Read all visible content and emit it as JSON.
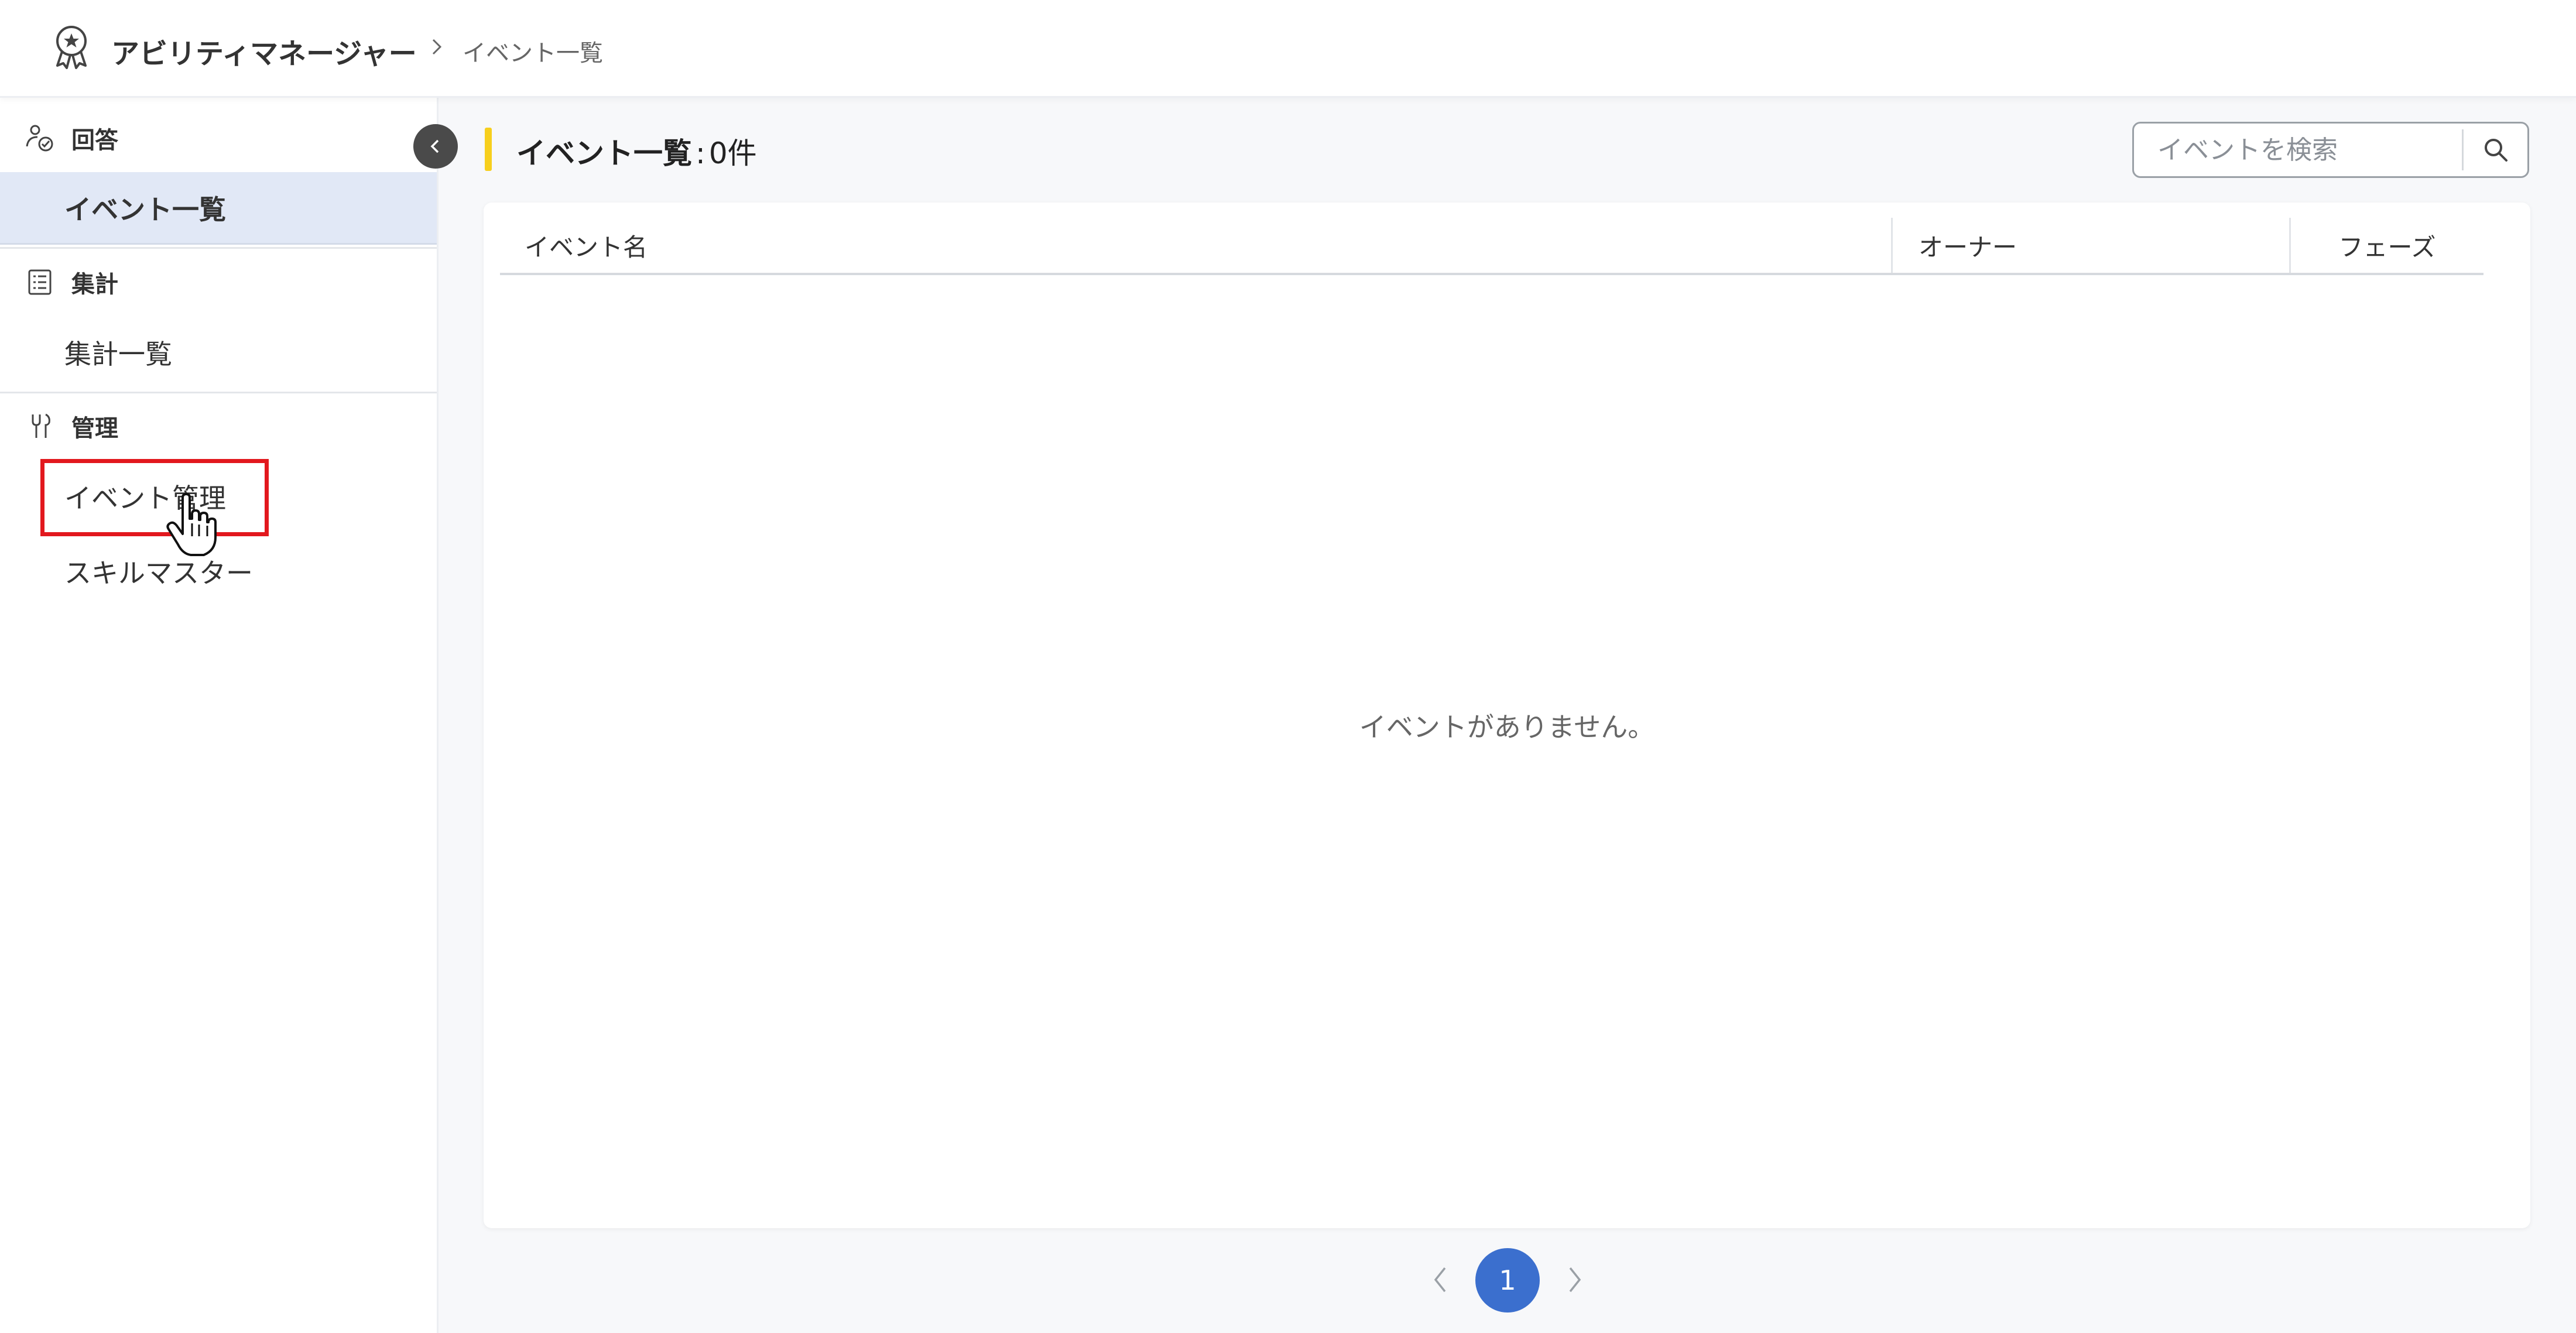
{
  "header": {
    "app_title": "アビリティマネージャー",
    "breadcrumb_current": "イベント一覧",
    "logo_icon": "award-badge-icon",
    "separator_icon": "chevron-right-icon"
  },
  "sidebar": {
    "collapse_icon": "chevron-left-icon",
    "sections": [
      {
        "title": "回答",
        "icon": "person-check-icon",
        "items": [
          {
            "label": "イベント一覧",
            "active": true
          }
        ]
      },
      {
        "title": "集計",
        "icon": "list-document-icon",
        "items": [
          {
            "label": "集計一覧",
            "active": false
          }
        ]
      },
      {
        "title": "管理",
        "icon": "tools-icon",
        "items": [
          {
            "label": "イベント管理",
            "active": false,
            "highlighted": true
          },
          {
            "label": "スキルマスター",
            "active": false
          }
        ]
      }
    ]
  },
  "main": {
    "list_label": "イベント一覧",
    "list_colon": ":",
    "list_count": "0件",
    "search": {
      "placeholder": "イベントを検索",
      "value": ""
    },
    "table": {
      "columns": [
        "イベント名",
        "オーナー",
        "フェーズ"
      ],
      "rows": [],
      "empty_message": "イベントがありません。"
    },
    "pagination": {
      "current_page": "1"
    }
  },
  "colors": {
    "accent_yellow": "#f7cf1d",
    "active_nav_bg": "#e1e8f6",
    "page_button": "#3b6fce",
    "highlight_red": "#e2181e"
  }
}
